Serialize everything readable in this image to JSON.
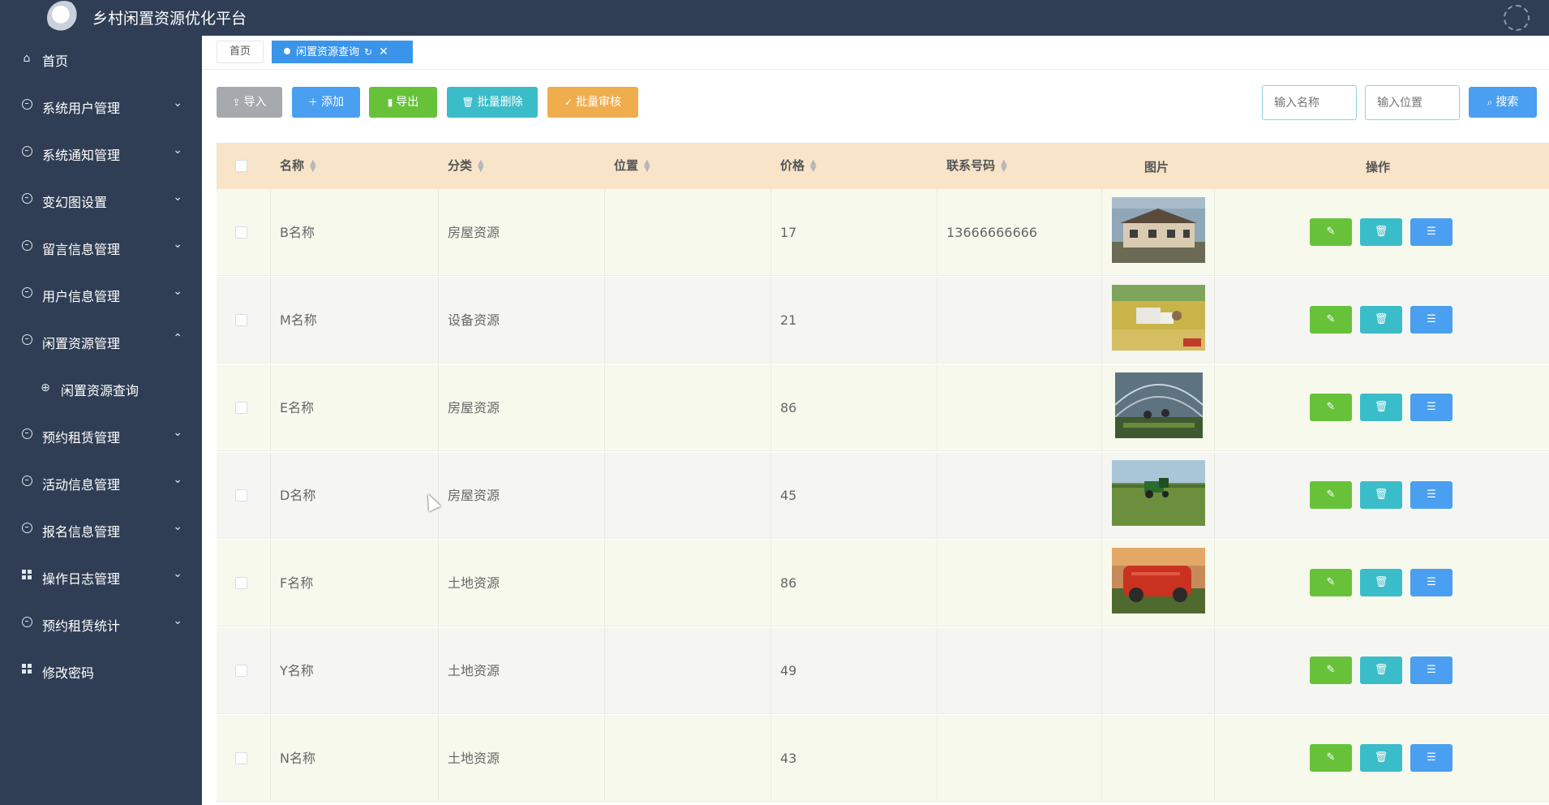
{
  "header": {
    "title": "乡村闲置资源优化平台"
  },
  "sidebar": {
    "items": [
      {
        "label": "首页",
        "icon": "home-icon"
      },
      {
        "label": "系统用户管理",
        "icon": "circle-minus-icon"
      },
      {
        "label": "系统通知管理",
        "icon": "circle-minus-icon"
      },
      {
        "label": "变幻图设置",
        "icon": "circle-minus-icon"
      },
      {
        "label": "留言信息管理",
        "icon": "circle-minus-icon"
      },
      {
        "label": "用户信息管理",
        "icon": "circle-minus-icon"
      },
      {
        "label": "闲置资源管理",
        "icon": "circle-minus-icon",
        "expanded": true
      },
      {
        "label": "闲置资源查询",
        "icon": "circle-plus-icon",
        "sub": true
      },
      {
        "label": "预约租赁管理",
        "icon": "circle-minus-icon"
      },
      {
        "label": "活动信息管理",
        "icon": "circle-minus-icon"
      },
      {
        "label": "报名信息管理",
        "icon": "circle-minus-icon"
      },
      {
        "label": "操作日志管理",
        "icon": "grid-icon"
      },
      {
        "label": "预约租赁统计",
        "icon": "circle-minus-icon"
      },
      {
        "label": "修改密码",
        "icon": "grid-icon"
      }
    ]
  },
  "tabs": {
    "home": "首页",
    "active": "闲置资源查询"
  },
  "toolbar": {
    "import": "导入",
    "add": "添加",
    "export": "导出",
    "batch_delete": "批量删除",
    "batch_audit": "批量审核",
    "search": "搜索",
    "name_placeholder": "输入名称",
    "location_placeholder": "输入位置"
  },
  "table": {
    "columns": {
      "name": "名称",
      "category": "分类",
      "location": "位置",
      "price": "价格",
      "phone": "联系号码",
      "image": "图片",
      "actions": "操作"
    },
    "rows": [
      {
        "name": "B名称",
        "category": "房屋资源",
        "location": "",
        "price": "17",
        "phone": "13666666666",
        "image": "house"
      },
      {
        "name": "M名称",
        "category": "设备资源",
        "location": "",
        "price": "21",
        "phone": "",
        "image": "harvest"
      },
      {
        "name": "E名称",
        "category": "房屋资源",
        "location": "",
        "price": "86",
        "phone": "",
        "image": "greenhouse"
      },
      {
        "name": "D名称",
        "category": "房屋资源",
        "location": "",
        "price": "45",
        "phone": "",
        "image": "tractor"
      },
      {
        "name": "F名称",
        "category": "土地资源",
        "location": "",
        "price": "86",
        "phone": "",
        "image": "baler"
      },
      {
        "name": "Y名称",
        "category": "土地资源",
        "location": "",
        "price": "49",
        "phone": "",
        "image": ""
      },
      {
        "name": "N名称",
        "category": "土地资源",
        "location": "",
        "price": "43",
        "phone": "",
        "image": ""
      }
    ]
  },
  "colors": {
    "sidebar": "#2f3e54",
    "primary": "#4a9ff0",
    "success": "#67c23a",
    "info": "#3bbcc9",
    "warning": "#f0ad4e",
    "table_header": "#f7e4c9"
  }
}
